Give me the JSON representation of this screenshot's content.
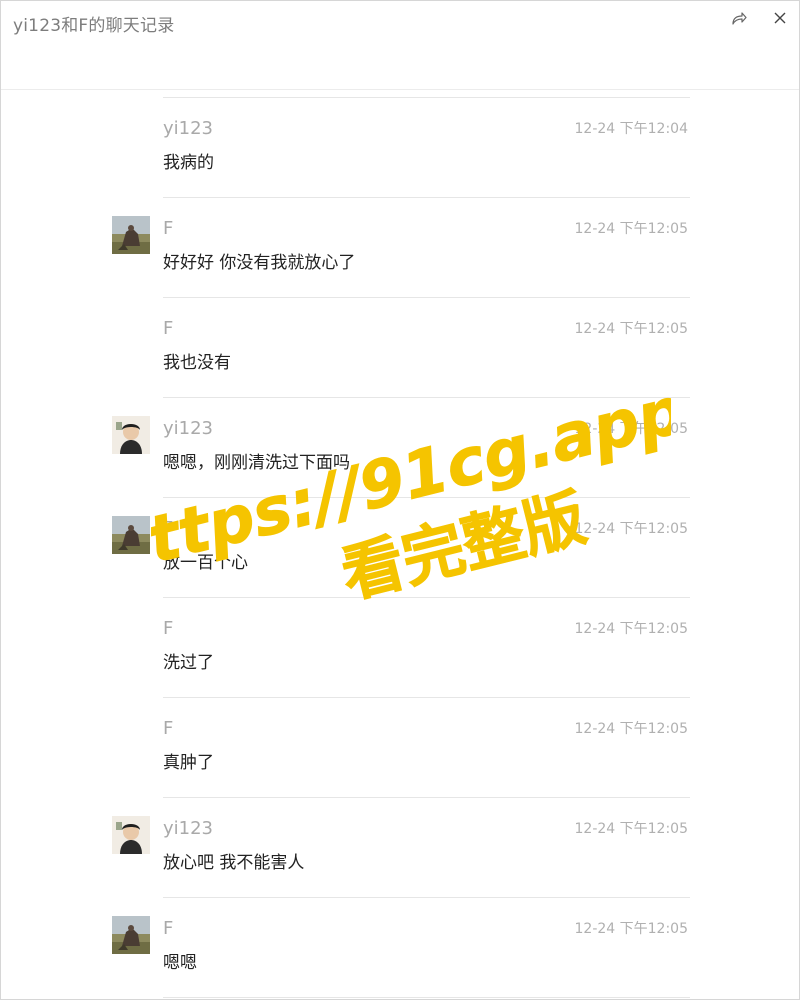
{
  "window": {
    "title": "yi123和F的聊天记录"
  },
  "toolbar": {
    "share_icon": "share-icon",
    "close_icon": "close-icon"
  },
  "messages": [
    {
      "sender": "yi123",
      "time": "12-24 下午12:04",
      "text": "我病的",
      "avatar": "none"
    },
    {
      "sender": "F",
      "time": "12-24 下午12:05",
      "text": "好好好 你没有我就放心了",
      "avatar": "landscape-avatar"
    },
    {
      "sender": "F",
      "time": "12-24 下午12:05",
      "text": "我也没有",
      "avatar": "none"
    },
    {
      "sender": "yi123",
      "time": "12-24 下午12:05",
      "text": "嗯嗯，刚刚清洗过下面吗",
      "avatar": "person-avatar"
    },
    {
      "sender": "F",
      "time": "12-24 下午12:05",
      "text": "放一百个心",
      "avatar": "landscape-avatar"
    },
    {
      "sender": "F",
      "time": "12-24 下午12:05",
      "text": "洗过了",
      "avatar": "none"
    },
    {
      "sender": "F",
      "time": "12-24 下午12:05",
      "text": "真肿了",
      "avatar": "none"
    },
    {
      "sender": "yi123",
      "time": "12-24 下午12:05",
      "text": "放心吧 我不能害人",
      "avatar": "person-avatar"
    },
    {
      "sender": "F",
      "time": "12-24 下午12:05",
      "text": "嗯嗯",
      "avatar": "landscape-avatar"
    }
  ],
  "watermark": {
    "line1": "https://91cg.app/",
    "line2": "看完整版",
    "color": "#f5c400"
  }
}
